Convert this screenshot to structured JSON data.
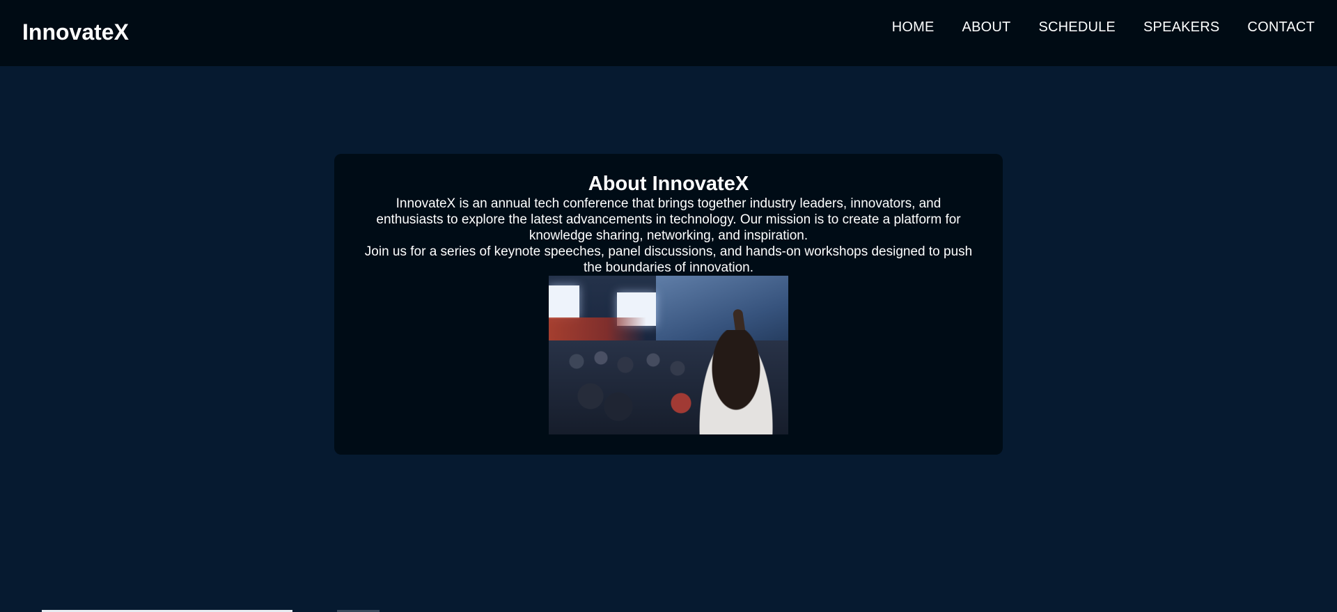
{
  "header": {
    "brand": "InnovateX",
    "nav": [
      {
        "label": "HOME"
      },
      {
        "label": "ABOUT"
      },
      {
        "label": "SCHEDULE"
      },
      {
        "label": "SPEAKERS"
      },
      {
        "label": "CONTACT"
      }
    ]
  },
  "about": {
    "title": "About InnovateX",
    "paragraph1": "InnovateX is an annual tech conference that brings together industry leaders, innovators, and enthusiasts to explore the latest advancements in technology. Our mission is to create a platform for knowledge sharing, networking, and inspiration.",
    "paragraph2": "Join us for a series of keynote speeches, panel discussions, and hands-on workshops designed to push the boundaries of innovation.",
    "image": "conference-audience-photo"
  },
  "colors": {
    "page_background": "#061a30",
    "header_background": "#000b14",
    "card_background": "#000c16",
    "text": "#ffffff"
  }
}
